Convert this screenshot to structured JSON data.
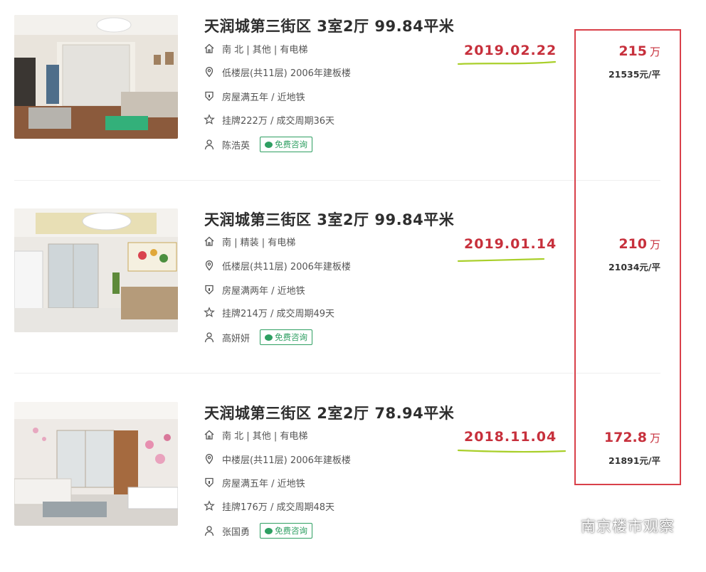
{
  "listings": [
    {
      "title": "天润城第三街区 3室2厅 99.84平米",
      "orientation": "南 北 | 其他 | 有电梯",
      "floor": "低楼层(共11层) 2006年建板楼",
      "tags": "房屋满五年 / 近地铁",
      "listing_info": "挂牌222万 / 成交周期36天",
      "agent": "陈浩英",
      "consult_label": "免费咨询",
      "deal_date": "2019.02.22",
      "price": "215",
      "price_unit": "万",
      "unit_price": "21535元/平"
    },
    {
      "title": "天润城第三街区 3室2厅 99.84平米",
      "orientation": "南 | 精装 | 有电梯",
      "floor": "低楼层(共11层) 2006年建板楼",
      "tags": "房屋满两年 / 近地铁",
      "listing_info": "挂牌214万 / 成交周期49天",
      "agent": "高妍妍",
      "consult_label": "免费咨询",
      "deal_date": "2019.01.14",
      "price": "210",
      "price_unit": "万",
      "unit_price": "21034元/平"
    },
    {
      "title": "天润城第三街区 2室2厅 78.94平米",
      "orientation": "南 北 | 其他 | 有电梯",
      "floor": "中楼层(共11层) 2006年建板楼",
      "tags": "房屋满五年 / 近地铁",
      "listing_info": "挂牌176万 / 成交周期48天",
      "agent": "张国勇",
      "consult_label": "免费咨询",
      "deal_date": "2018.11.04",
      "price": "172.8",
      "price_unit": "万",
      "unit_price": "21891元/平"
    }
  ],
  "watermark": {
    "text": "南京楼市观察"
  },
  "colors": {
    "accent_red": "#c7303c",
    "box_red": "#d9404a",
    "underline_green": "#a9cf2a",
    "consult_green": "#2f9f62"
  }
}
